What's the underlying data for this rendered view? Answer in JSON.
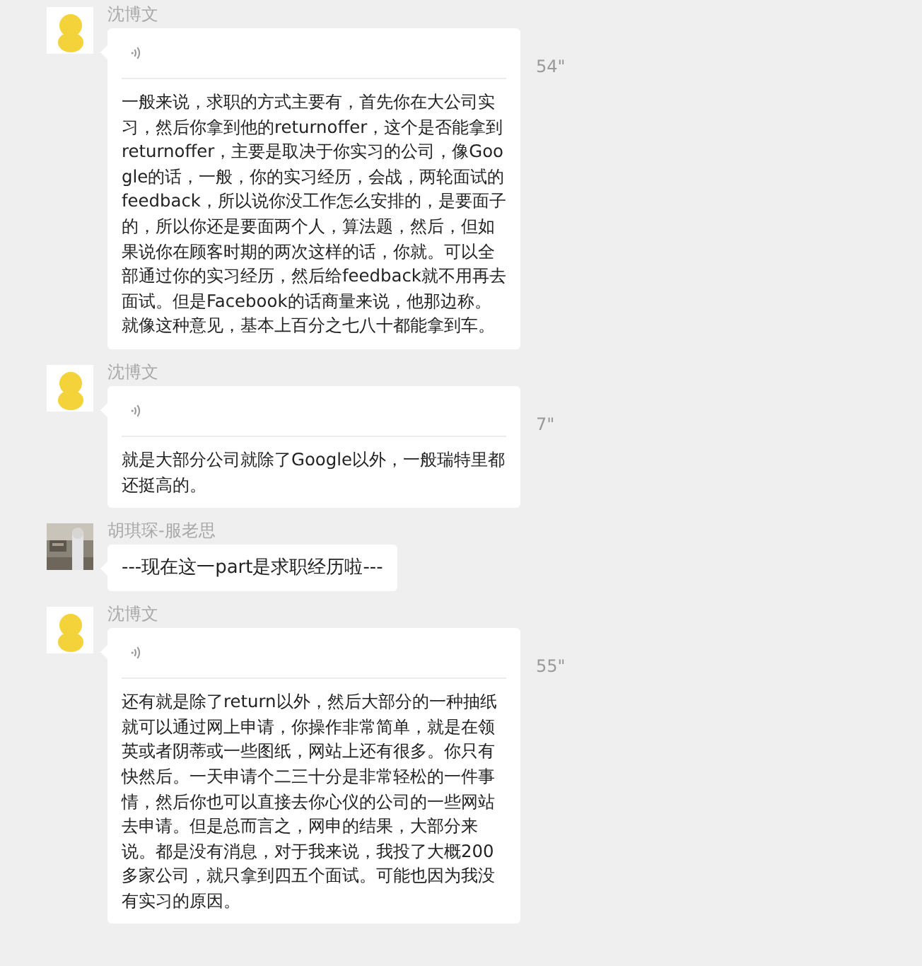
{
  "messages": [
    {
      "sender": "沈博文",
      "avatar": {
        "kind": "cartoon"
      },
      "kind": "voice",
      "duration": "54\"",
      "text": "一般来说，求职的方式主要有，首先你在大公司实习，然后你拿到他的returnoffer，这个是否能拿到returnoffer，主要是取决于你实习的公司，像Google的话，一般，你的实习经历，会战，两轮面试的feedback，所以说你没工作怎么安排的，是要面子的，所以你还是要面两个人，算法题，然后，但如果说你在顾客时期的两次这样的话，你就。可以全部通过你的实习经历，然后给feedback就不用再去面试。但是Facebook的话商量来说，他那边称。就像这种意见，基本上百分之七八十都能拿到车。"
    },
    {
      "sender": "沈博文",
      "avatar": {
        "kind": "cartoon"
      },
      "kind": "voice",
      "duration": "7\"",
      "text": "就是大部分公司就除了Google以外，一般瑞特里都还挺高的。"
    },
    {
      "sender": "胡琪琛-服老思",
      "kind": "text",
      "text": "---现在这一part是求职经历啦---"
    },
    {
      "sender": "沈博文",
      "avatar": {
        "kind": "cartoon"
      },
      "kind": "voice",
      "duration": "55\"",
      "text": "还有就是除了return以外，然后大部分的一种抽纸就可以通过网上申请，你操作非常简单，就是在领英或者阴蒂或一些图纸，网站上还有很多。你只有快然后。一天申请个二三十分是非常轻松的一件事情，然后你也可以直接去你心仪的公司的一些网站去申请。但是总而言之，网申的结果，大部分来说。都是没有消息，对于我来说，我投了大概200多家公司，就只拿到四五个面试。可能也因为我没有实习的原因。"
    }
  ]
}
